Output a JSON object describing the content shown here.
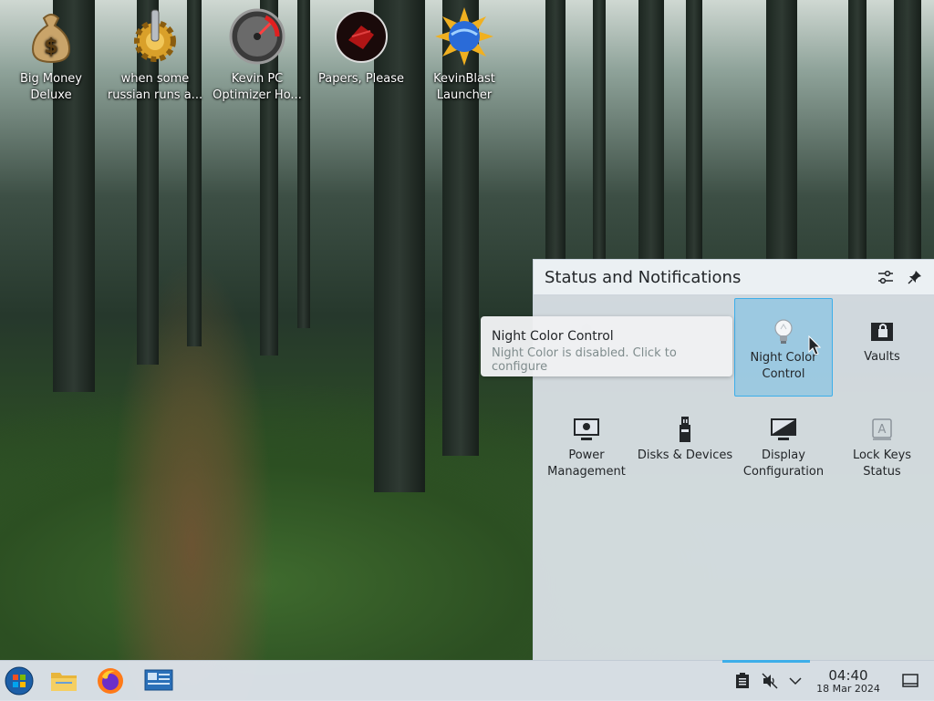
{
  "desktop": {
    "icons": [
      {
        "label_line1": "Big Money",
        "label_line2": "Deluxe",
        "icon": "money-bag-icon"
      },
      {
        "label_line1": "when some",
        "label_line2": "russian runs a...",
        "icon": "gear-icon"
      },
      {
        "label_line1": "Kevin PC",
        "label_line2": "Optimizer Ho...",
        "icon": "gauge-icon"
      },
      {
        "label_line1": "Papers, Please",
        "label_line2": "",
        "icon": "papers-please-icon"
      },
      {
        "label_line1": "KevinBlast",
        "label_line2": "Launcher",
        "icon": "globe-burst-icon"
      }
    ]
  },
  "popup": {
    "title": "Status and Notifications",
    "items": [
      {
        "label_line1": "Night Color",
        "label_line2": "Control",
        "icon": "lightbulb-icon",
        "active": true
      },
      {
        "label_line1": "Vaults",
        "label_line2": "",
        "icon": "vault-lock-icon"
      },
      {
        "label_line1": "Power",
        "label_line2": "Management",
        "icon": "monitor-power-icon"
      },
      {
        "label_line1": "Disks & Devices",
        "label_line2": "",
        "icon": "usb-drive-icon"
      },
      {
        "label_line1": "Display",
        "label_line2": "Configuration",
        "icon": "display-config-icon"
      },
      {
        "label_line1": "Lock Keys",
        "label_line2": "Status",
        "icon": "keyboard-lock-icon"
      }
    ]
  },
  "tooltip": {
    "title": "Night Color Control",
    "subtitle": "Night Color is disabled. Click to configure"
  },
  "taskbar": {
    "time": "04:40",
    "date": "18 Mar 2024",
    "accent": "#3daee9"
  }
}
